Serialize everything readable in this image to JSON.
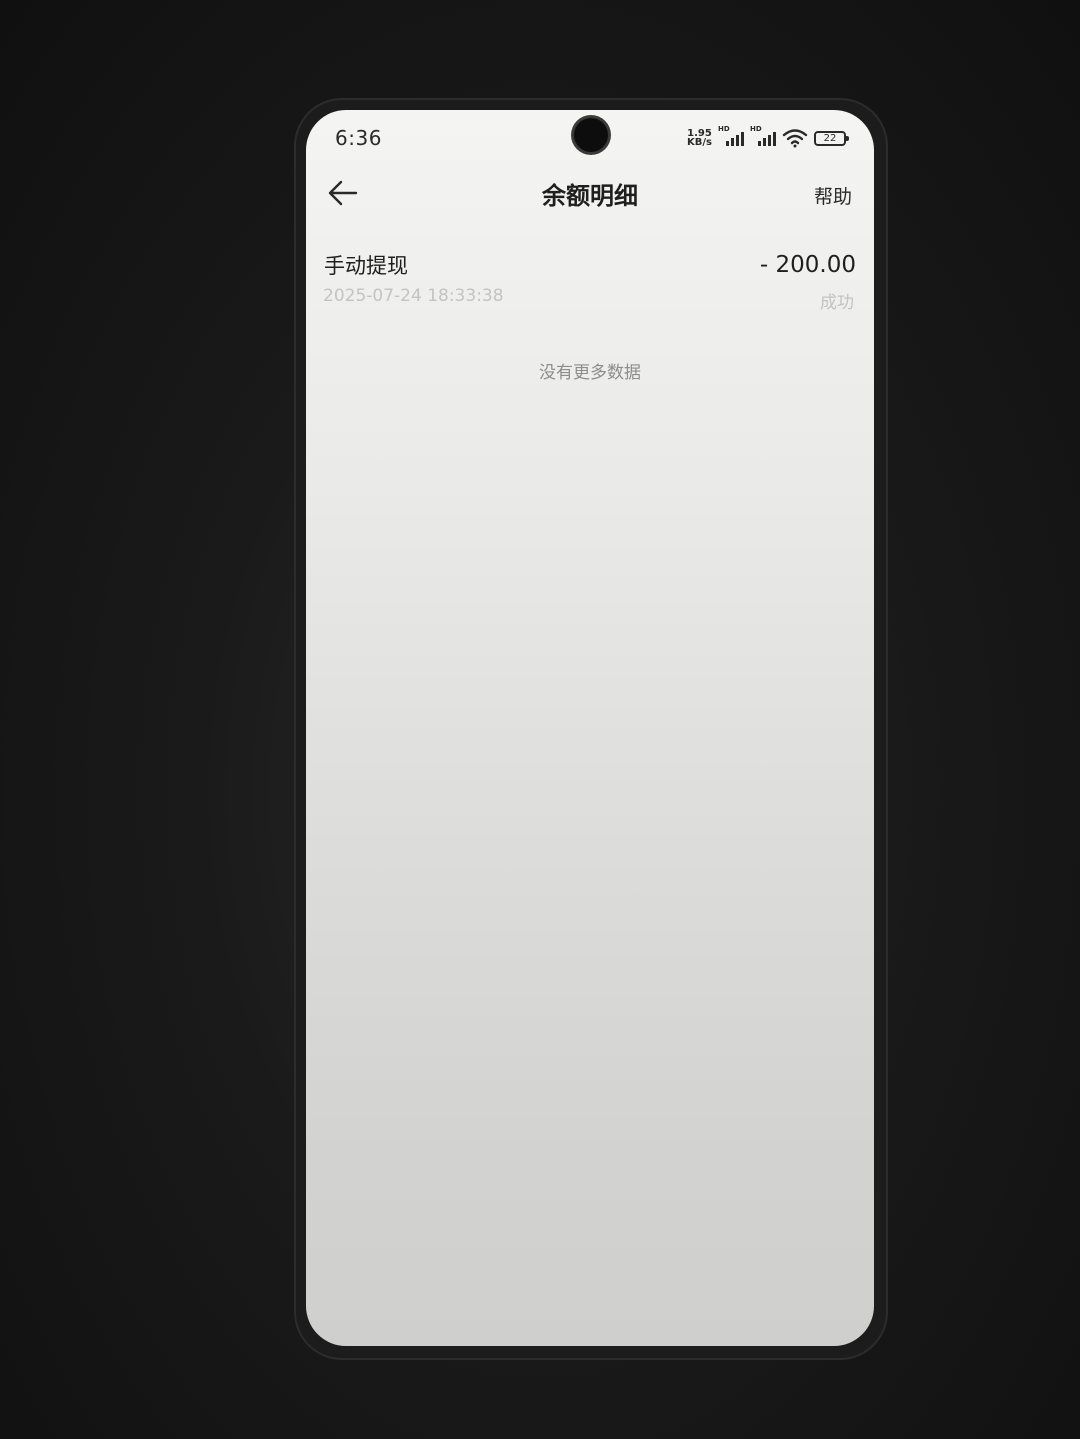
{
  "status_bar": {
    "time": "6:36",
    "net_speed_value": "1.95",
    "net_speed_unit": "KB/s",
    "sim1_label": "HD",
    "sim2_label": "HD",
    "battery": "22"
  },
  "nav": {
    "title": "余额明细",
    "help_label": "帮助",
    "back_icon": "arrow-left-icon"
  },
  "records": [
    {
      "title": "手动提现",
      "time": "2025-07-24 18:33:38",
      "amount": "- 200.00",
      "status": "成功"
    }
  ],
  "footer_text": "没有更多数据",
  "colors": {
    "text_primary": "#1f1f1f",
    "text_secondary": "#c3c3c1",
    "text_hint": "#8d8d8b",
    "screen_bg": "#f4f4f3"
  }
}
